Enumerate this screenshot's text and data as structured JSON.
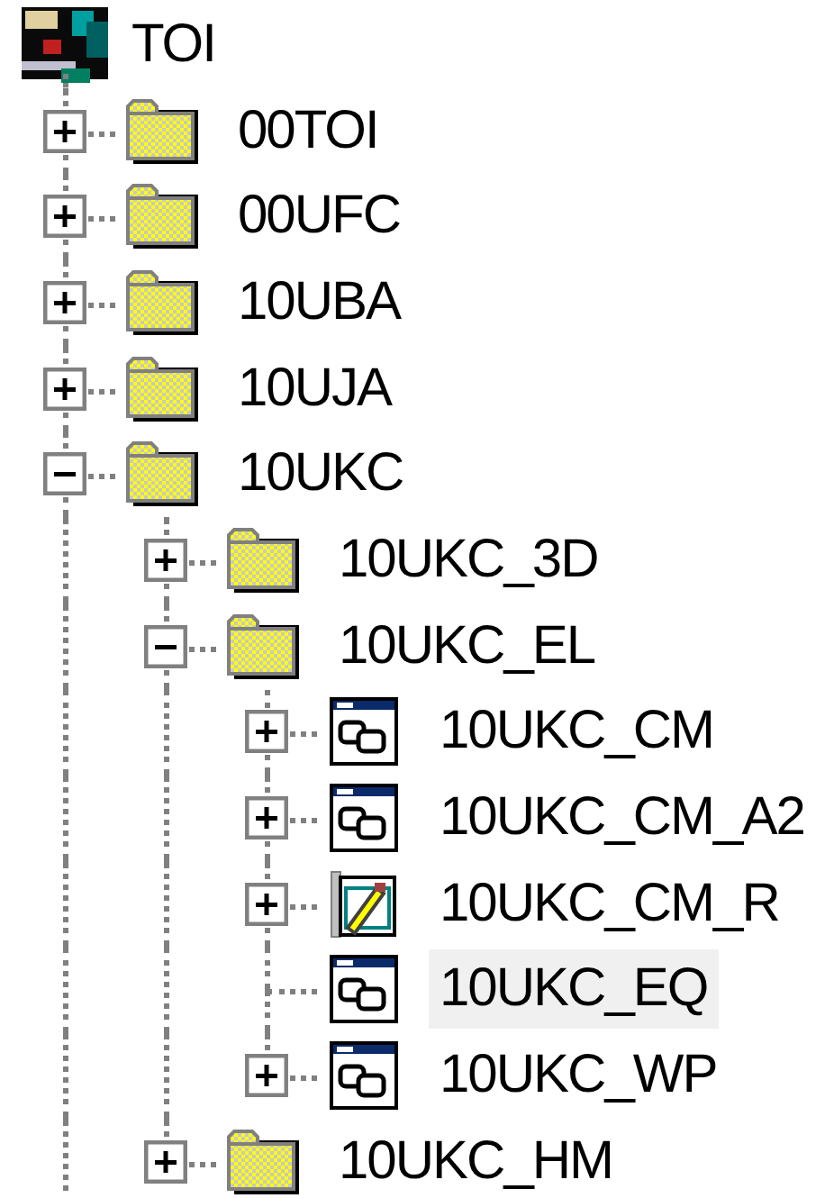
{
  "tree": {
    "label": "TOI",
    "kind": "root",
    "selected": false,
    "children": [
      {
        "label": "00TOI",
        "kind": "folder",
        "expanded": false,
        "selected": false
      },
      {
        "label": "00UFC",
        "kind": "folder",
        "expanded": false,
        "selected": false
      },
      {
        "label": "10UBA",
        "kind": "folder",
        "expanded": false,
        "selected": false
      },
      {
        "label": "10UJA",
        "kind": "folder",
        "expanded": false,
        "selected": false
      },
      {
        "label": "10UKC",
        "kind": "folder",
        "expanded": true,
        "selected": false,
        "children": [
          {
            "label": "10UKC_3D",
            "kind": "folder",
            "expanded": false,
            "selected": false
          },
          {
            "label": "10UKC_EL",
            "kind": "folder",
            "expanded": true,
            "selected": false,
            "children": [
              {
                "label": "10UKC_CM",
                "kind": "window",
                "expanded": false,
                "selected": false
              },
              {
                "label": "10UKC_CM_A2",
                "kind": "window",
                "expanded": false,
                "selected": false
              },
              {
                "label": "10UKC_CM_R",
                "kind": "document",
                "expanded": false,
                "selected": false
              },
              {
                "label": "10UKC_EQ",
                "kind": "window",
                "selected": true
              },
              {
                "label": "10UKC_WP",
                "kind": "window",
                "expanded": false,
                "selected": false
              }
            ]
          },
          {
            "label": "10UKC_HM",
            "kind": "folder",
            "expanded": false,
            "selected": false
          }
        ]
      }
    ]
  }
}
